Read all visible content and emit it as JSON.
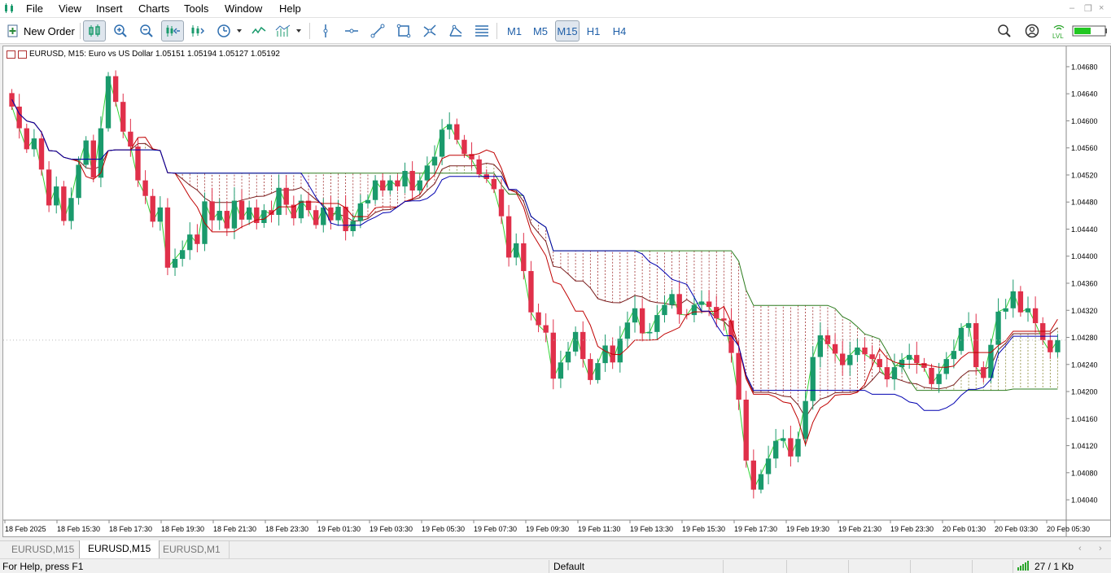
{
  "menu": [
    "File",
    "View",
    "Insert",
    "Charts",
    "Tools",
    "Window",
    "Help"
  ],
  "toolbar": {
    "new_order_label": "New Order",
    "timeframes": [
      "M1",
      "M5",
      "M15",
      "H1",
      "H4"
    ],
    "active_timeframe": "M15"
  },
  "chart": {
    "title": "EURUSD, M15:  Euro vs US Dollar  1.05151 1.05194 1.05127 1.05192",
    "price_labels": [
      "1.04680",
      "1.04640",
      "1.04600",
      "1.04560",
      "1.04520",
      "1.04480",
      "1.04440",
      "1.04400",
      "1.04360",
      "1.04320",
      "1.04280",
      "1.04240",
      "1.04200",
      "1.04160",
      "1.04120",
      "1.04080",
      "1.04040"
    ],
    "time_labels": [
      "18 Feb 2025",
      "18 Feb 15:30",
      "18 Feb 17:30",
      "18 Feb 19:30",
      "18 Feb 21:30",
      "18 Feb 23:30",
      "19 Feb 01:30",
      "19 Feb 03:30",
      "19 Feb 05:30",
      "19 Feb 07:30",
      "19 Feb 09:30",
      "19 Feb 11:30",
      "19 Feb 13:30",
      "19 Feb 15:30",
      "19 Feb 17:30",
      "19 Feb 19:30",
      "19 Feb 21:30",
      "19 Feb 23:30",
      "20 Feb 01:30",
      "20 Feb 03:30",
      "20 Feb 05:30"
    ],
    "colors": {
      "bull": "#1a9a6c",
      "bear": "#e0304a",
      "tenkan": "#c00000",
      "kijun": "#0000b0",
      "chikou": "#32d232",
      "span": "#7a1e1e",
      "span_b": "#2e7d20"
    }
  },
  "chart_data": {
    "type": "candlestick",
    "title": "EURUSD, M15:  Euro vs US Dollar  1.05151 1.05194 1.05127 1.05192",
    "ylim": [
      1.0401,
      1.0471
    ],
    "close": [
      1.04621,
      1.04589,
      1.04558,
      1.04574,
      1.04528,
      1.04475,
      1.04503,
      1.04452,
      1.04486,
      1.04535,
      1.04571,
      1.04516,
      1.04589,
      1.04666,
      1.04628,
      1.04584,
      1.04562,
      1.04512,
      1.04489,
      1.04451,
      1.04472,
      1.04383,
      1.04396,
      1.04409,
      1.04432,
      1.04418,
      1.04481,
      1.04453,
      1.04467,
      1.04441,
      1.04482,
      1.04454,
      1.04472,
      1.04449,
      1.04468,
      1.04461,
      1.04501,
      1.04476,
      1.04456,
      1.04482,
      1.04468,
      1.04446,
      1.04472,
      1.04453,
      1.04473,
      1.04437,
      1.04452,
      1.04478,
      1.04483,
      1.04512,
      1.04497,
      1.04512,
      1.04503,
      1.04526,
      1.04497,
      1.04512,
      1.04534,
      1.04547,
      1.04587,
      1.04595,
      1.04572,
      1.04551,
      1.04543,
      1.04521,
      1.04514,
      1.04499,
      1.04459,
      1.04398,
      1.04419,
      1.04378,
      1.04317,
      1.04298,
      1.04287,
      1.04219,
      1.04243,
      1.04259,
      1.04288,
      1.04248,
      1.04217,
      1.04242,
      1.04268,
      1.04243,
      1.04278,
      1.04302,
      1.04323,
      1.04286,
      1.04288,
      1.04313,
      1.04328,
      1.04344,
      1.04314,
      1.04313,
      1.04328,
      1.04333,
      1.04325,
      1.04308,
      1.04305,
      1.04257,
      1.04188,
      1.04098,
      1.04055,
      1.04078,
      1.04101,
      1.04127,
      1.04131,
      1.04104,
      1.0413,
      1.04186,
      1.04251,
      1.04283,
      1.0427,
      1.04256,
      1.04239,
      1.04254,
      1.04265,
      1.04255,
      1.04248,
      1.04236,
      1.04218,
      1.04236,
      1.04247,
      1.04254,
      1.04242,
      1.04235,
      1.04211,
      1.04226,
      1.04248,
      1.0426,
      1.04294,
      1.04301,
      1.04236,
      1.0422,
      1.04269,
      1.04318,
      1.04323,
      1.04348,
      1.04317,
      1.04323,
      1.04301,
      1.04276,
      1.04258,
      1.04276
    ]
  }
}
